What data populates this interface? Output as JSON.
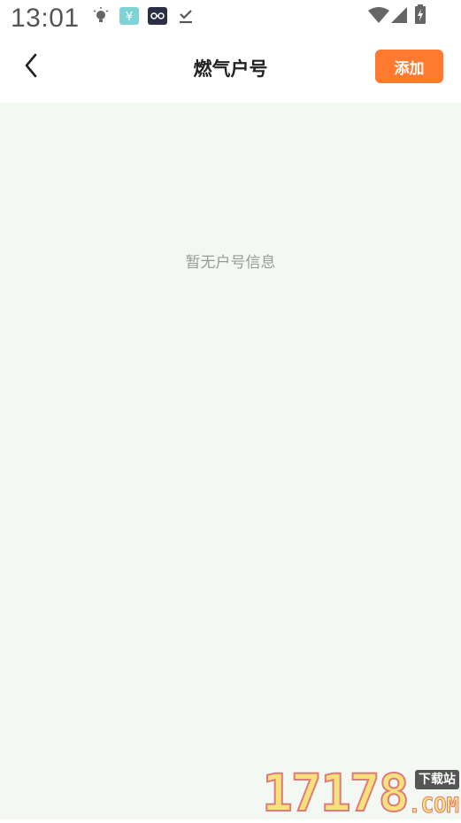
{
  "status_bar": {
    "time": "13:01",
    "icons": [
      "bulb-icon",
      "app-yen-icon",
      "app-glasses-icon",
      "download-done-icon",
      "wifi-icon",
      "signal-icon",
      "battery-charging-icon"
    ]
  },
  "header": {
    "title": "燃气户号",
    "add_label": "添加"
  },
  "content": {
    "empty_message": "暂无户号信息"
  },
  "watermark": {
    "digits": "17178",
    "badge": "下载站",
    "suffix": ".COM"
  },
  "colors": {
    "accent": "#ff7a2e",
    "content_bg": "#f3f9f2",
    "empty_text": "#9a9a9a"
  }
}
